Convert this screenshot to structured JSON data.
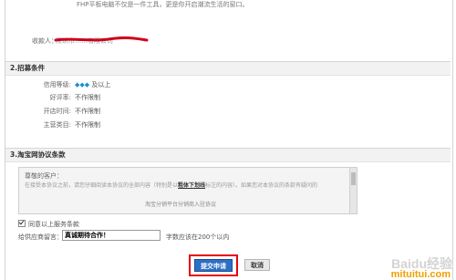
{
  "section1": {
    "line1": "FHP平板电脑不仅是一件工具，更是你开启潮流生活的窗口。",
    "line2": "",
    "recipient_label": "收款人：",
    "recipient_value": "深圳市……有限公司"
  },
  "section2": {
    "title": "2.招募条件",
    "rows": [
      {
        "label": "信用等级:",
        "value": "及以上",
        "icon": "diamond-icon"
      },
      {
        "label": "好评率:",
        "value": "不作限制"
      },
      {
        "label": "开店时间:",
        "value": "不作限制"
      },
      {
        "label": "主营类目:",
        "value": "不作限制"
      }
    ]
  },
  "section3": {
    "title": "3.淘宝网协议条款",
    "agreement": {
      "greeting": "尊敬的客户：",
      "body_prefix": "在接受本协议之前，请您仔细阅读本协议的全部内容（特别是以",
      "body_bold": "粗体下划线",
      "body_suffix": "标注的内容）。如果您对本协议的条款有疑问的",
      "title": "淘宝分销平台分销商入驻协议"
    },
    "checkbox_label": "同意以上服务条款",
    "message_label": "给供应商留言：",
    "message_value": "真诚期待合作！",
    "message_hint": "字数应该在200个以内"
  },
  "buttons": {
    "submit": "提交申请",
    "cancel": "取消"
  },
  "watermark": {
    "line1": "Baidu经验",
    "line2": "mituitui.com"
  },
  "colors": {
    "submit_bg": "#2d6fc4",
    "highlight_red": "#e60012",
    "diamond": "#1a8fd6"
  }
}
